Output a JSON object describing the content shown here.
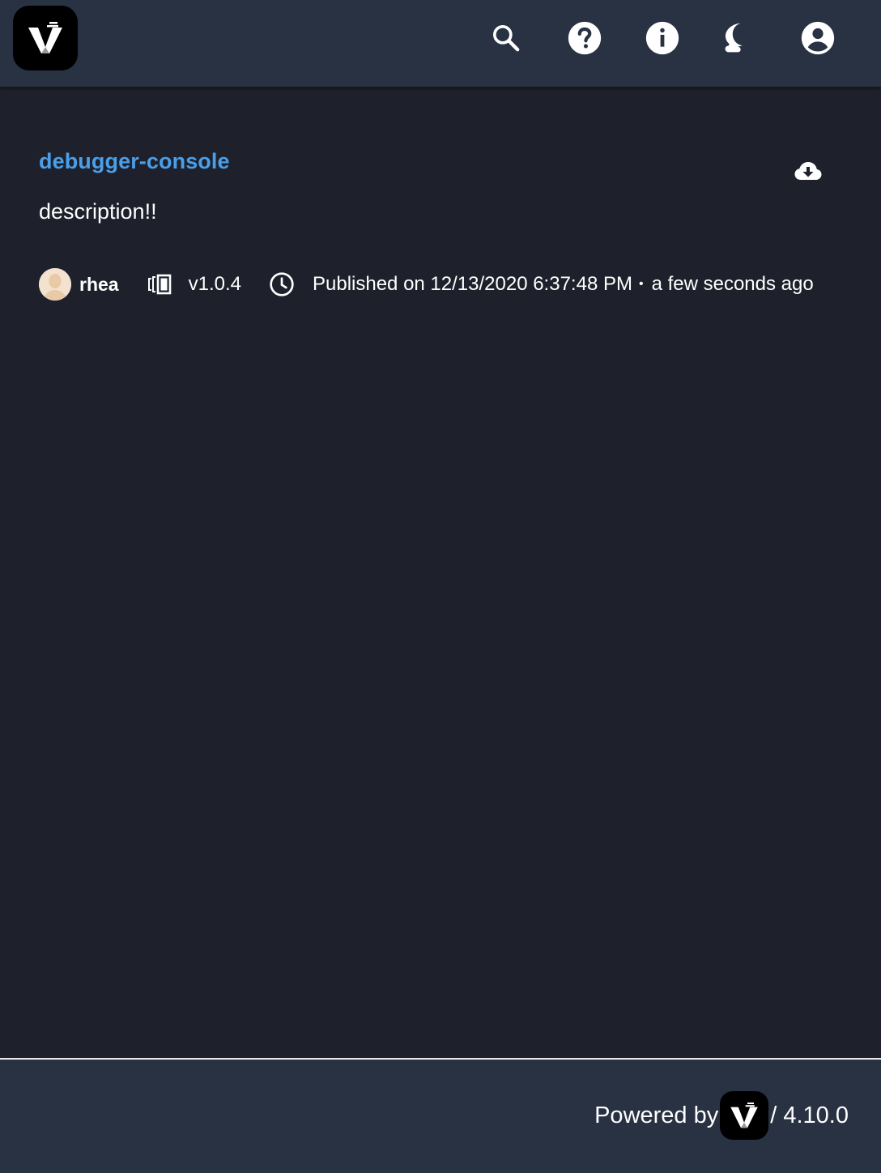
{
  "header": {
    "icons": [
      "search-icon",
      "help-icon",
      "info-icon",
      "theme-toggle-icon",
      "account-icon"
    ]
  },
  "package": {
    "name": "debugger-console",
    "description": "description!!",
    "author": "rhea",
    "version": "v1.0.4",
    "published": "Published on 12/13/2020 6:37:48 PM",
    "separator": "•",
    "relative_time": "a few seconds ago"
  },
  "footer": {
    "powered_by": "Powered by",
    "version": "/ 4.10.0"
  },
  "colors": {
    "header_bg": "#283242",
    "page_bg": "#1e212b",
    "link": "#4b9ee8"
  }
}
